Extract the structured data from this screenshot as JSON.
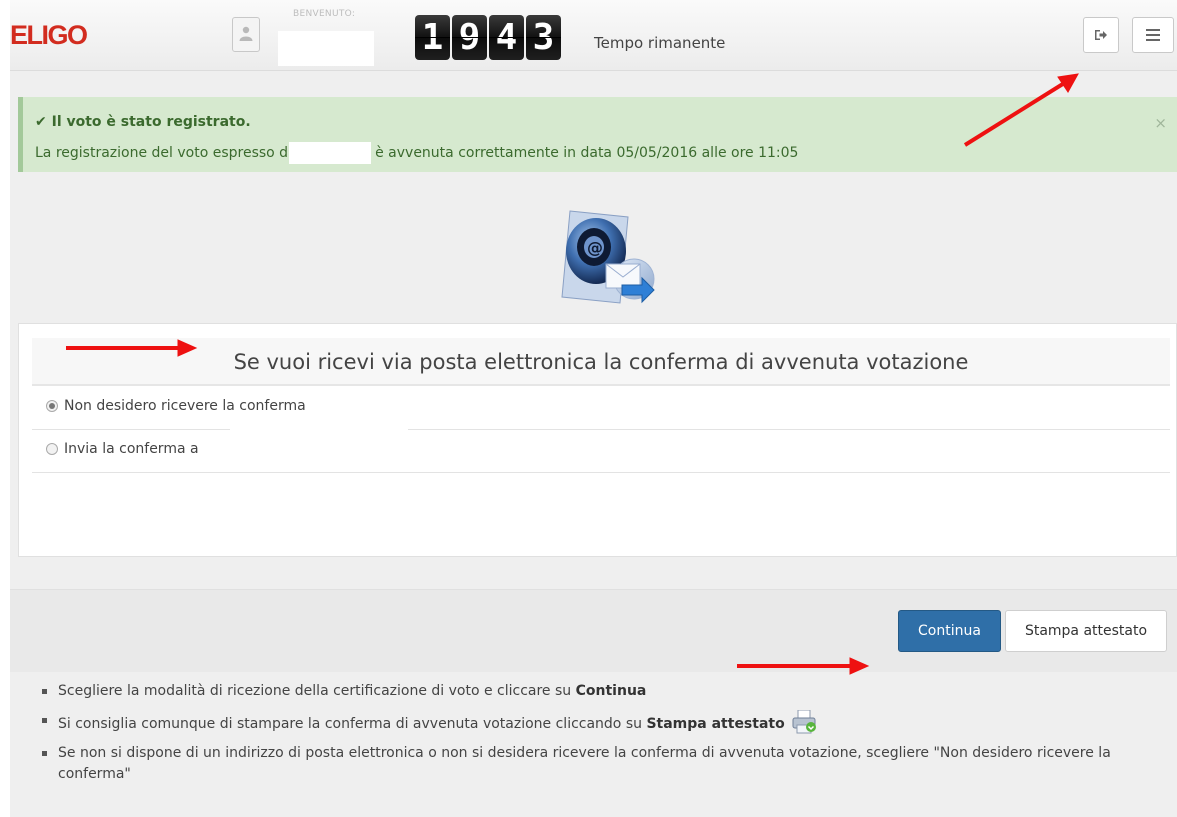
{
  "header": {
    "logo": "ELIGO",
    "welcome_label": "BENVENUTO:",
    "timer_digits": [
      "1",
      "9",
      "4",
      "3"
    ],
    "timer_label": "Tempo rimanente",
    "icons": {
      "avatar": "user-icon",
      "logout": "sign-out-icon",
      "menu": "hamburger-menu-icon"
    }
  },
  "alert": {
    "title": "✔ Il voto è stato registrato.",
    "text_before": "La registrazione del voto espresso da",
    "text_after": "è avvenuta correttamente in data 05/05/2016 alle ore 11:05",
    "close": "×",
    "colors": {
      "background": "#d6e9cf",
      "text": "#3b6a2e"
    }
  },
  "panel": {
    "title": "Se vuoi ricevi via posta elettronica la conferma di avvenuta votazione",
    "options": [
      {
        "label": "Non desidero ricevere la conferma",
        "checked": true
      },
      {
        "label": "Invia la conferma a",
        "checked": false
      }
    ]
  },
  "actions": {
    "continue_label": "Continua",
    "print_label": "Stampa attestato",
    "primary_color": "#2f6fa8"
  },
  "instructions": [
    {
      "before": "Scegliere la modalità di ricezione della certificazione di voto e cliccare su ",
      "bold": "Continua",
      "after": ""
    },
    {
      "before": "Si consiglia comunque di stampare la conferma di avvenuta votazione cliccando su ",
      "bold": "Stampa attestato",
      "after": ""
    },
    {
      "before": "Se non si dispone di un indirizzo di posta elettronica o non si desidera ricevere la conferma di avvenuta votazione, scegliere \"Non desidero ricevere la conferma\"",
      "bold": "",
      "after": ""
    }
  ],
  "annotation_color": "#ee1111"
}
